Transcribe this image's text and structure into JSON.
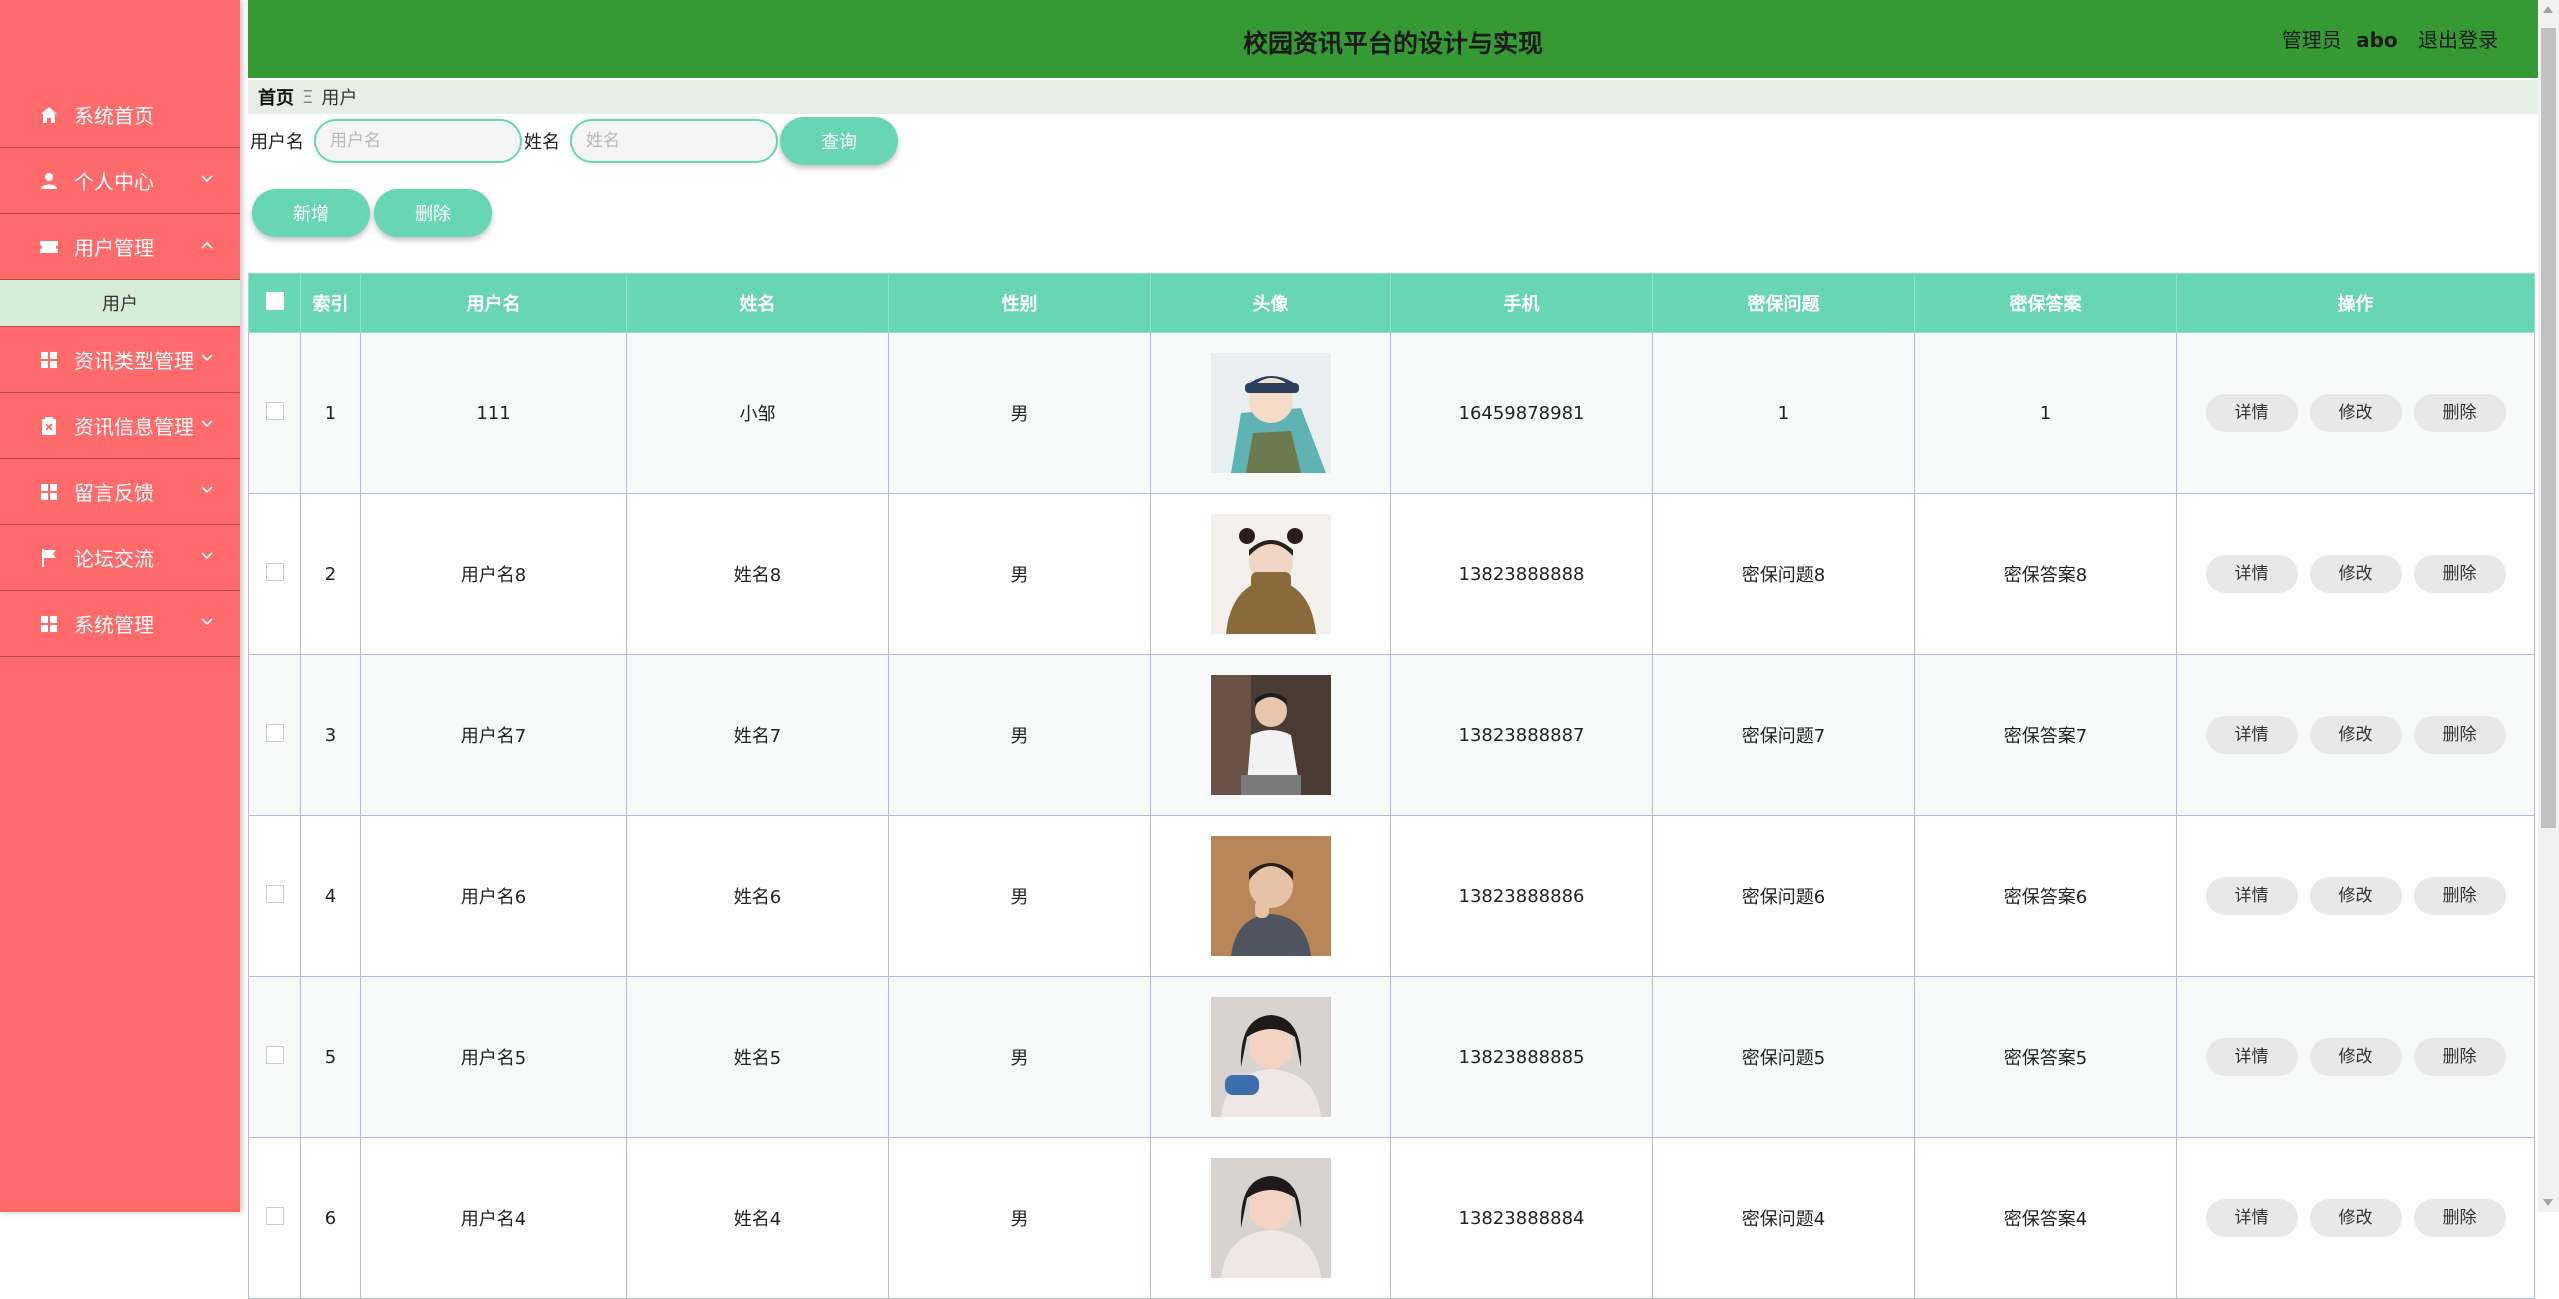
{
  "header": {
    "title": "校园资讯平台的设计与实现",
    "role": "管理员",
    "username": "abo",
    "logout": "退出登录"
  },
  "sidebar": {
    "items": [
      {
        "label": "系统首页",
        "icon": "home-icon",
        "expandable": false
      },
      {
        "label": "个人中心",
        "icon": "user-icon",
        "expandable": true
      },
      {
        "label": "用户管理",
        "icon": "ticket-icon",
        "expandable": true,
        "expanded": true
      },
      {
        "label": "资讯类型管理",
        "icon": "grid-icon",
        "expandable": true
      },
      {
        "label": "资讯信息管理",
        "icon": "trash-box-icon",
        "expandable": true
      },
      {
        "label": "留言反馈",
        "icon": "grid-icon",
        "expandable": true
      },
      {
        "label": "论坛交流",
        "icon": "flag-icon",
        "expandable": true
      },
      {
        "label": "系统管理",
        "icon": "grid-icon",
        "expandable": true
      }
    ],
    "submenu_active": "用户"
  },
  "breadcrumb": {
    "home": "首页",
    "separator": "Ξ",
    "current": "用户"
  },
  "search": {
    "username_label": "用户名",
    "username_placeholder": "用户名",
    "name_label": "姓名",
    "name_placeholder": "姓名",
    "query_button": "查询"
  },
  "toolbar": {
    "add_label": "新增",
    "delete_label": "删除"
  },
  "table": {
    "columns": [
      "索引",
      "用户名",
      "姓名",
      "性别",
      "头像",
      "手机",
      "密保问题",
      "密保答案",
      "操作"
    ],
    "rows": [
      {
        "index": "1",
        "username": "111",
        "name": "小邹",
        "gender": "男",
        "avatar": "anime-boy-cap",
        "phone": "16459878981",
        "question": "1",
        "answer": "1"
      },
      {
        "index": "2",
        "username": "用户名8",
        "name": "姓名8",
        "gender": "男",
        "avatar": "girl-buns-sweater",
        "phone": "13823888888",
        "question": "密保问题8",
        "answer": "密保答案8"
      },
      {
        "index": "3",
        "username": "用户名7",
        "name": "姓名7",
        "gender": "男",
        "avatar": "man-white-shirt",
        "phone": "13823888887",
        "question": "密保问题7",
        "answer": "密保答案7"
      },
      {
        "index": "4",
        "username": "用户名6",
        "name": "姓名6",
        "gender": "男",
        "avatar": "boy-thinking",
        "phone": "13823888886",
        "question": "密保问题6",
        "answer": "密保答案6"
      },
      {
        "index": "5",
        "username": "用户名5",
        "name": "姓名5",
        "gender": "男",
        "avatar": "girl-smiling",
        "phone": "13823888885",
        "question": "密保问题5",
        "answer": "密保答案5"
      },
      {
        "index": "6",
        "username": "用户名4",
        "name": "姓名4",
        "gender": "男",
        "avatar": "girl-smiling-2",
        "phone": "13823888884",
        "question": "密保问题4",
        "answer": "密保答案4"
      }
    ],
    "row_actions": {
      "detail": "详情",
      "edit": "修改",
      "delete": "删除"
    }
  },
  "colors": {
    "sidebar_bg": "#ff6a6a",
    "header_bg": "#359a34",
    "accent": "#68d5b4"
  }
}
